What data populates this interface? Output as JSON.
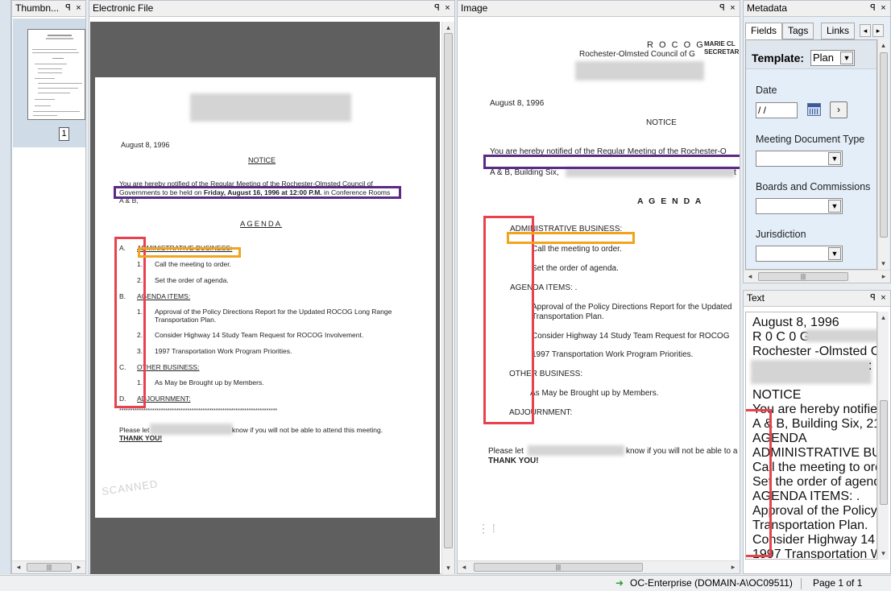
{
  "panes": {
    "thumbnails": {
      "title": "Thumbn...",
      "page_number": "1"
    },
    "electronic": {
      "title": "Electronic File"
    },
    "image": {
      "title": "Image"
    },
    "metadata": {
      "title": "Metadata",
      "tabs": [
        "Fields",
        "Tags",
        "Links"
      ],
      "template_label": "Template:",
      "template_value": "Plan",
      "fields": [
        {
          "label": "Date",
          "value": " / /"
        },
        {
          "label": "Meeting Document Type",
          "value": ""
        },
        {
          "label": "Boards and Commissions",
          "value": ""
        },
        {
          "label": "Jurisdiction",
          "value": ""
        }
      ]
    },
    "text": {
      "title": "Text"
    }
  },
  "pane_buttons": {
    "pin": "ᵖ",
    "close": "×"
  },
  "scan_doc": {
    "date": "August 8, 1996",
    "notice": "NOTICE",
    "para1_line1": "You are hereby notified of the Regular Meeting of the Rochester-Olmsted Council of",
    "para1_line2_a": "Governments to be held on ",
    "para1_line2_b": "Friday, August 16, 1996 at 12:00 P.M.",
    "para1_line2_c": " in Conference Rooms",
    "para1_line3": "A & B,",
    "agenda": "AGENDA",
    "a_letter": "A.",
    "a_head": "ADMINISTRATIVE BUSINESS:",
    "a1_num": "1.",
    "a1": "Call the meeting to order.",
    "a2_num": "2.",
    "a2": "Set the order of agenda.",
    "b_letter": "B.",
    "b_head": "AGENDA ITEMS:",
    "b1_num": "1.",
    "b1_line1": "Approval of the  Policy Directions Report for the Updated ROCOG Long Range",
    "b1_line2": "Transportation Plan.",
    "b2_num": "2.",
    "b2": "Consider Highway 14 Study Team Request for ROCOG Involvement.",
    "b3_num": "3.",
    "b3": "1997 Transportation Work Program Priorities.",
    "c_letter": "C.",
    "c_head": "OTHER BUSINESS:",
    "c1_num": "1.",
    "c1": "As May be Brought up by Members.",
    "d_letter": "D.",
    "d_head": "ADJOURNMENT:",
    "stars": "************************************************************************",
    "please_a": "Please let",
    "please_b": "know if you will not be able to attend this meeting.",
    "thanks": "THANK YOU!",
    "stamp": "SCANNED"
  },
  "image_doc": {
    "rocog": "R O C O G",
    "org": "Rochester-Olmsted Council of G",
    "marie": "MARIE CL",
    "secretary": "SECRETAR",
    "date": "August 8, 1996",
    "notice": "NOTICE",
    "para_line1": "You are hereby notified of the Regular Meeting of the Rochester-O",
    "para_line3": "A & B, Building Six,",
    "para_tail": "t",
    "agenda": "A G E N D A",
    "a_head": "ADMINISTRATIVE BUSINESS:",
    "a1": "Call the meeting to order.",
    "a2": "Set the order of agenda.",
    "b_head": "AGENDA ITEMS: .",
    "b1_line1": "Approval of the  Policy Directions Report for the Updated",
    "b1_line2": "Transportation Plan.",
    "b2": "Consider Highway 14 Study Team Request for ROCOG",
    "b3": "1997 Transportation Work Program Priorities.",
    "c_head": "OTHER BUSINESS:",
    "c1": "As May be Brought up by Members.",
    "d_head": "ADJOURNMENT:",
    "please_a": "Please let",
    "please_b": "know if you will not be able to a",
    "thanks": "THANK YOU!"
  },
  "ocr_lines": [
    "August 8, 1996",
    "R 0 C 0 G",
    "Rochester -Olmsted C",
    ":",
    "NOTICE",
    "You are hereby notified",
    "A & B, Building Six, 21",
    "AGENDA",
    "ADMINISTRATIVE BU",
    "Call the meeting to ord",
    "Set the order of agenda",
    "AGENDA ITEMS: .",
    "Approval of the Policy",
    "Transportation Plan.",
    "Consider Highway 14",
    "1997 Transportation W"
  ],
  "status": {
    "connection": "OC-Enterprise (DOMAIN-A\\OC09511)",
    "page": "Page 1 of 1"
  }
}
